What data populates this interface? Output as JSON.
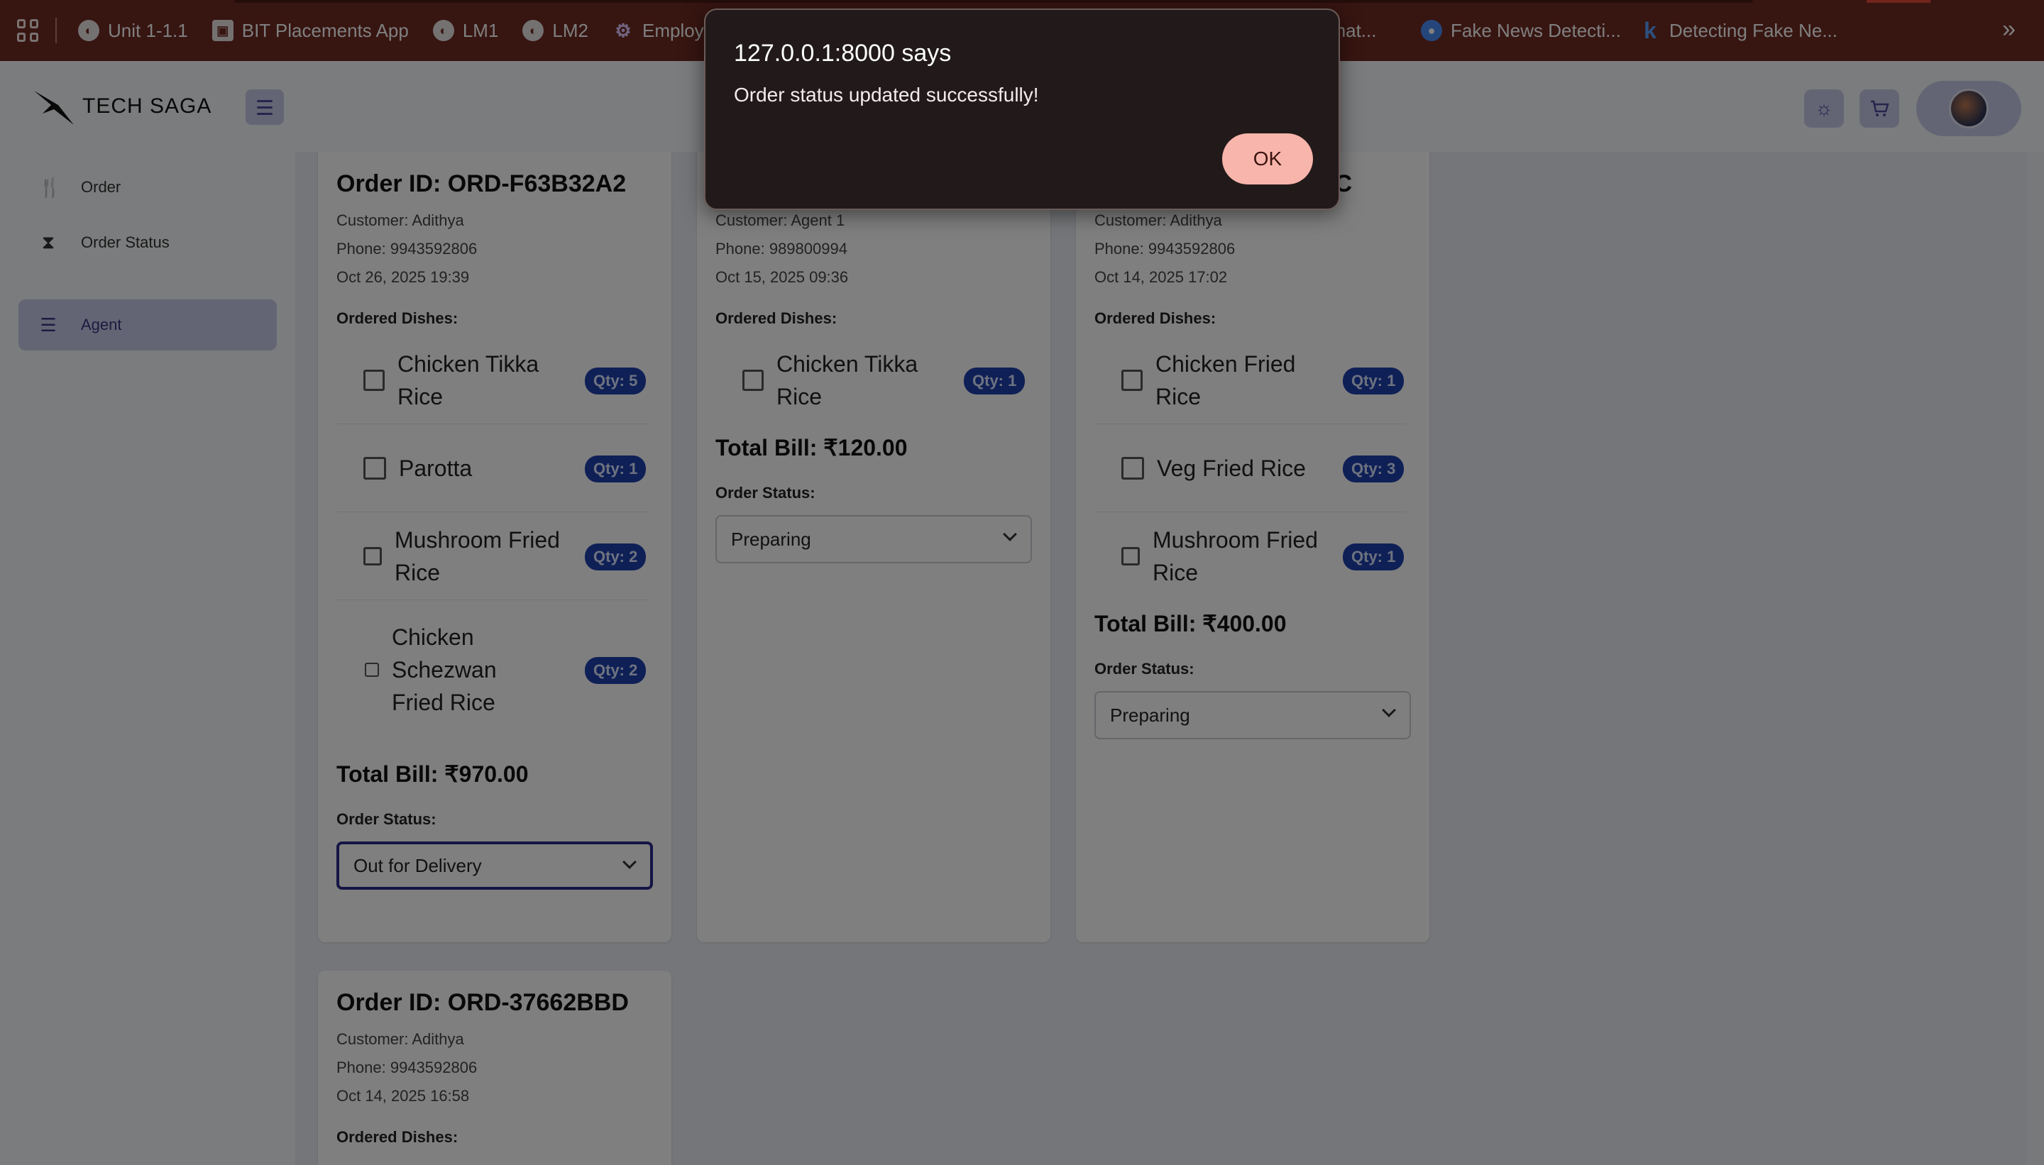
{
  "bookmarks": {
    "items": [
      {
        "label": "Unit 1-1.1",
        "icon": "globe-icon"
      },
      {
        "label": "BIT Placements App",
        "icon": "bit-logo-icon"
      },
      {
        "label": "LM1",
        "icon": "globe-icon"
      },
      {
        "label": "LM2",
        "icon": "globe-icon"
      },
      {
        "label": "Employe",
        "icon": "gear-icon"
      },
      {
        "label": "omat...",
        "icon": "globe-icon"
      },
      {
        "label": "Fake News Detecti...",
        "icon": "blue-globe-icon"
      },
      {
        "label": "Detecting Fake Ne...",
        "icon": "k-icon"
      }
    ],
    "more": "»"
  },
  "header": {
    "brand": "TECH SAGA"
  },
  "sidebar": {
    "items": [
      {
        "label": "Order",
        "icon": "fork-knife-icon",
        "active": false
      },
      {
        "label": "Order Status",
        "icon": "hourglass-icon",
        "active": false
      },
      {
        "label": "Agent",
        "icon": "list-icon",
        "active": true
      }
    ]
  },
  "labels": {
    "ordered_dishes": "Ordered Dishes:",
    "order_status": "Order Status:"
  },
  "orders": [
    {
      "id": "Order ID: ORD-F63B32A2",
      "customer": "Customer: Adithya",
      "phone": "Phone: 9943592806",
      "date": "Oct 26, 2025 19:39",
      "dishes": [
        {
          "name": "Chicken Tikka Rice",
          "qty": "Qty: 5"
        },
        {
          "name": "Parotta",
          "qty": "Qty: 1"
        },
        {
          "name": "Mushroom Fried Rice",
          "qty": "Qty: 2"
        },
        {
          "name": "Chicken Schezwan Fried Rice",
          "qty": "Qty: 2"
        }
      ],
      "total": "Total Bill: ₹970.00",
      "status": "Out for Delivery"
    },
    {
      "id": "",
      "customer": "Customer: Agent 1",
      "phone": "Phone: 989800994",
      "date": "Oct 15, 2025 09:36",
      "dishes": [
        {
          "name": "Chicken Tikka Rice",
          "qty": "Qty: 1"
        }
      ],
      "total": "Total Bill: ₹120.00",
      "status": "Preparing"
    },
    {
      "id": "CC",
      "customer": "Customer: Adithya",
      "phone": "Phone: 9943592806",
      "date": "Oct 14, 2025 17:02",
      "dishes": [
        {
          "name": "Chicken Fried Rice",
          "qty": "Qty: 1"
        },
        {
          "name": "Veg Fried Rice",
          "qty": "Qty: 3"
        },
        {
          "name": "Mushroom Fried Rice",
          "qty": "Qty: 1"
        }
      ],
      "total": "Total Bill: ₹400.00",
      "status": "Preparing"
    },
    {
      "id": "Order ID: ORD-37662BBD",
      "customer": "Customer: Adithya",
      "phone": "Phone: 9943592806",
      "date": "Oct 14, 2025 16:58"
    }
  ],
  "dialog": {
    "title": "127.0.0.1:8000 says",
    "message": "Order status updated successfully!",
    "ok_label": "OK"
  }
}
